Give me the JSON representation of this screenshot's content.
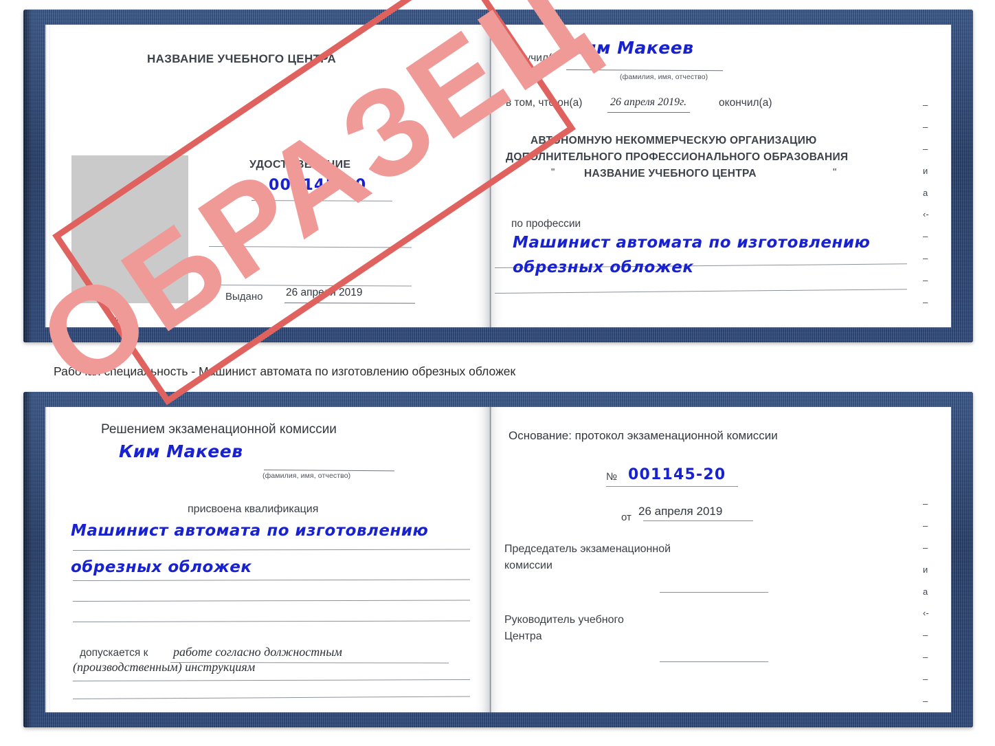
{
  "caption": "Рабочая специальность - Машинист автомата по изготовлению обрезных обложек",
  "stamp": {
    "text": "ОБРАЗЕЦ",
    "border_color": "#e0625f",
    "text_color": "#f09a98"
  },
  "colors": {
    "cover_navy": "#22407a",
    "paper_white": "#ffffff",
    "ink_blue": "#1822d0",
    "print_gray": "#3a3f46",
    "photo_gray": "#cacaca",
    "rule_gray": "#8d929a"
  },
  "certificate_top": {
    "left_page": {
      "center_name": "НАЗВАНИЕ УЧЕБНОГО ЦЕНТРА",
      "doc_type": "УДОСТОВЕРЕНИЕ",
      "number_label": "№",
      "number_value": "001145-20",
      "issued_label": "Выдано",
      "issued_value": "26 апреля 2019",
      "seal_label": "М.П.",
      "photo_placeholder": "photo-box"
    },
    "right_page": {
      "received_label": "Получил(а)",
      "received_value": "Ким Макеев",
      "received_hint": "(фамилия, имя, отчество)",
      "in_that_label": "в том, что он(а)",
      "completion_date": "26 апреля 2019г.",
      "finished_label": "окончил(а)",
      "org_line1": "АВТОНОМНУЮ НЕКОММЕРЧЕСКУЮ ОРГАНИЗАЦИЮ",
      "org_line2": "ДОПОЛНИТЕЛЬНОГО ПРОФЕССИОНАЛЬНОГО ОБРАЗОВАНИЯ",
      "org_quote_open": "\"",
      "org_line3": "НАЗВАНИЕ УЧЕБНОГО ЦЕНТРА",
      "org_quote_close": "\"",
      "profession_label": "по профессии",
      "profession_line1": "Машинист автомата по изготовлению",
      "profession_line2": "обрезных обложек",
      "margin_fragments": [
        "–",
        "–",
        "–",
        "и",
        "а",
        "‹-",
        "–",
        "–",
        "–",
        "–"
      ]
    }
  },
  "certificate_bottom": {
    "left_page": {
      "heading": "Решением экзаменационной комиссии",
      "name_value": "Ким Макеев",
      "name_hint": "(фамилия, имя, отчество)",
      "qualification_label": "присвоена квалификация",
      "qualification_line1": "Машинист автомата по изготовлению",
      "qualification_line2": "обрезных обложек",
      "admitted_label": "допускается к",
      "admitted_line1": "работе согласно должностным",
      "admitted_line2": "(производственным) инструкциям"
    },
    "right_page": {
      "basis_label": "Основание: протокол экзаменационной комиссии",
      "number_label": "№",
      "number_value": "001145-20",
      "date_label": "от",
      "date_value": "26 апреля 2019",
      "chairman_line1": "Председатель экзаменационной",
      "chairman_line2": "комиссии",
      "head_line1": "Руководитель учебного",
      "head_line2": "Центра",
      "margin_fragments": [
        "–",
        "–",
        "–",
        "и",
        "а",
        "‹-",
        "–",
        "–",
        "–",
        "–"
      ]
    }
  }
}
